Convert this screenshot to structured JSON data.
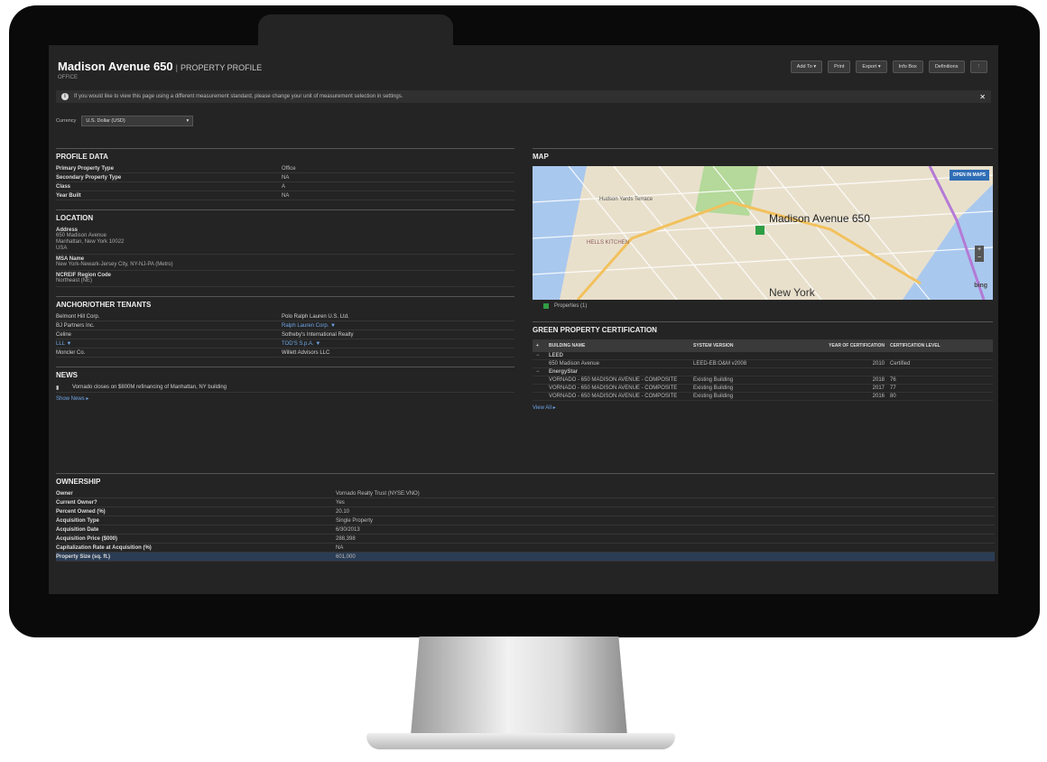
{
  "header": {
    "title": "Madison Avenue 650",
    "separator": "|",
    "subtitle": "PROPERTY PROFILE",
    "property_type": "OFFICE",
    "toolbar": [
      "Add To",
      "Print",
      "Export",
      "Info Box",
      "Definitions"
    ],
    "dropdown_glyph": "▾",
    "more_glyph": "⋮"
  },
  "banner": {
    "icon": "i",
    "text": "If you would like to view this page using a different measurement standard, please change your unit of measurement selection in settings.",
    "close": "✕"
  },
  "currency": {
    "label": "Currency",
    "value": "U.S. Dollar (USD)",
    "chevron": "▾"
  },
  "profile": {
    "title": "PROFILE DATA",
    "rows": [
      {
        "k": "Primary Property Type",
        "v": "Office"
      },
      {
        "k": "Secondary Property Type",
        "v": "NA"
      },
      {
        "k": "Class",
        "v": "A"
      },
      {
        "k": "Year Built",
        "v": "NA"
      }
    ]
  },
  "location": {
    "title": "LOCATION",
    "address_label": "Address",
    "address_lines": [
      "650 Madison Avenue",
      "Manhattan, New York 10022",
      "USA"
    ],
    "msa_label": "MSA Name",
    "msa_value": "New York-Newark-Jersey City, NY-NJ-PA (Metro)",
    "region_label": "NCREIF Region Code",
    "region_value": "Northeast (NE)"
  },
  "tenants": {
    "title": "ANCHOR/OTHER TENANTS",
    "rows": [
      {
        "left": "Belmont Hill Corp.",
        "left_link": false,
        "right": "Polo Ralph Lauren U.S. Ltd.",
        "right_link": false
      },
      {
        "left": "BJ Partners Inc.",
        "left_link": false,
        "right": "Ralph Lauren Corp. ▼",
        "right_link": true
      },
      {
        "left": "Celine",
        "left_link": false,
        "right": "Sotheby's International Realty",
        "right_link": false
      },
      {
        "left": "LLL ▼",
        "left_link": true,
        "right": "TOD'S S.p.A. ▼",
        "right_link": true
      },
      {
        "left": "Moncler Co.",
        "left_link": false,
        "right": "Willett Advisors LLC",
        "right_link": false
      }
    ]
  },
  "news": {
    "title": "NEWS",
    "items": [
      "Vornado closes on $800M refinancing of Manhattan, NY building"
    ],
    "more": "Show News ▸"
  },
  "map": {
    "title": "MAP",
    "label": "Madison Avenue 650",
    "place_labels": [
      "Hudson Yards Terrace",
      "HELLS KITCHEN",
      "New York"
    ],
    "open_button": "OPEN IN MAPS",
    "zoom_in": "+",
    "zoom_out": "−",
    "brand": "bing",
    "legend": "Properties (1)",
    "colors": {
      "land": "#e9e0cc",
      "park": "#b4d99a",
      "water": "#a9c8ee",
      "highway": "#f2c15c",
      "marker": "#2f9e44"
    }
  },
  "cert": {
    "title": "GREEN PROPERTY CERTIFICATION",
    "headers": [
      "BUILDING NAME",
      "SYSTEM VERSION",
      "YEAR OF CERTIFICATION",
      "CERTIFICATION LEVEL"
    ],
    "groups": [
      {
        "name": "LEED",
        "rows": [
          {
            "building": "650 Madison Avenue",
            "version": "LEED-EB:O&M v2008",
            "year": "2010",
            "level": "Certified"
          }
        ]
      },
      {
        "name": "EnergyStar",
        "rows": [
          {
            "building": "VORNADO - 650 MADISON AVENUE - COMPOSITE",
            "version": "Existing Building",
            "year": "2018",
            "level": "76"
          },
          {
            "building": "VORNADO - 650 MADISON AVENUE - COMPOSITE",
            "version": "Existing Building",
            "year": "2017",
            "level": "77"
          },
          {
            "building": "VORNADO - 650 MADISON AVENUE - COMPOSITE",
            "version": "Existing Building",
            "year": "2016",
            "level": "80"
          }
        ]
      }
    ],
    "view_all": "View All ▸"
  },
  "ownership": {
    "title": "OWNERSHIP",
    "rows": [
      {
        "k": "Owner",
        "v": "Vornado Realty Trust (NYSE:VNO)",
        "link": true
      },
      {
        "k": "Current Owner?",
        "v": "Yes"
      },
      {
        "k": "Percent Owned (%)",
        "v": "20.10"
      },
      {
        "k": "Acquisition Type",
        "v": "Single Property"
      },
      {
        "k": "Acquisition Date",
        "v": "6/30/2013"
      },
      {
        "k": "Acquisition Price ($000)",
        "v": "288,398"
      },
      {
        "k": "Capitalization Rate at Acquisition (%)",
        "v": "NA"
      },
      {
        "k": "Property Size (sq. ft.)",
        "v": "601,000",
        "highlight": true
      }
    ]
  }
}
